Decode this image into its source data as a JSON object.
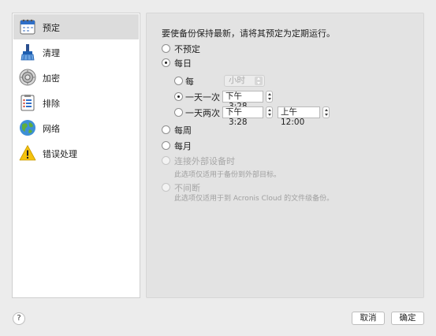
{
  "sidebar": {
    "items": [
      {
        "label": "预定",
        "icon": "calendar-icon",
        "selected": true
      },
      {
        "label": "清理",
        "icon": "broom-icon"
      },
      {
        "label": "加密",
        "icon": "vault-icon"
      },
      {
        "label": "排除",
        "icon": "list-icon"
      },
      {
        "label": "网络",
        "icon": "globe-icon"
      },
      {
        "label": "错误处理",
        "icon": "warning-icon"
      }
    ]
  },
  "main": {
    "heading": "要使备份保持最新，请将其预定为定期运行。",
    "options": {
      "none": "不预定",
      "daily": "每日",
      "every": "每",
      "every_unit": "小时",
      "once_a_day": "一天一次",
      "once_time_ampm": "下午",
      "once_time": "3:28",
      "twice_a_day": "一天两次",
      "twice_time1_ampm": "下午",
      "twice_time1": "3:28",
      "twice_time2": "上午12:00",
      "weekly": "每周",
      "monthly": "每月",
      "on_connect": "连接外部设备时",
      "on_connect_note": "此选项仅适用于备份到外部目标。",
      "continuous": "不间断",
      "continuous_note": "此选项仅适用于到 Acronis Cloud 的文件级备份。"
    },
    "selected": "daily",
    "daily_selected": "once_a_day"
  },
  "footer": {
    "help": "?",
    "cancel": "取消",
    "ok": "确定"
  },
  "colors": {
    "accent": "#000000",
    "sidebar_selected": "#dcdcdc",
    "panel_bg": "#e3e3e3"
  }
}
